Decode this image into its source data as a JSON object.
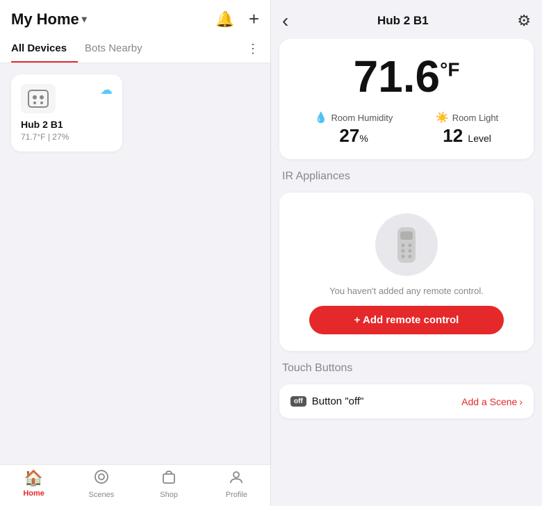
{
  "left": {
    "header": {
      "title": "My Home",
      "chevron": "▾",
      "bell_icon": "🔔",
      "plus_icon": "+"
    },
    "tabs": [
      {
        "id": "all-devices",
        "label": "All Devices",
        "active": true
      },
      {
        "id": "bots-nearby",
        "label": "Bots Nearby",
        "active": false
      }
    ],
    "more_icon": "⋮",
    "devices": [
      {
        "id": "hub2b1",
        "name": "Hub 2 B1",
        "stats": "71.7°F | 27%",
        "cloud_connected": true
      }
    ]
  },
  "bottom_nav": {
    "items": [
      {
        "id": "home",
        "label": "Home",
        "active": true,
        "icon": "🏠"
      },
      {
        "id": "scenes",
        "label": "Scenes",
        "active": false,
        "icon": "◎"
      },
      {
        "id": "shop",
        "label": "Shop",
        "active": false,
        "icon": "🛍"
      },
      {
        "id": "profile",
        "label": "Profile",
        "active": false,
        "icon": "👤"
      }
    ]
  },
  "right": {
    "header": {
      "back_icon": "‹",
      "title": "Hub 2 B1",
      "gear_icon": "⚙"
    },
    "temperature": {
      "value": "71.6",
      "unit": "°F"
    },
    "humidity": {
      "label": "Room Humidity",
      "value": "27",
      "unit": "%",
      "icon": "💧"
    },
    "light": {
      "label": "Room Light",
      "value": "12",
      "unit": "Level",
      "icon": "☀️"
    },
    "ir_section": {
      "label": "IR Appliances",
      "empty_text": "You haven't added any remote control.",
      "add_button": "+ Add remote control"
    },
    "touch_section": {
      "label": "Touch Buttons",
      "button_off_badge": "off",
      "button_name": "Button \"off\"",
      "add_scene_label": "Add a Scene",
      "chevron": "›"
    }
  }
}
